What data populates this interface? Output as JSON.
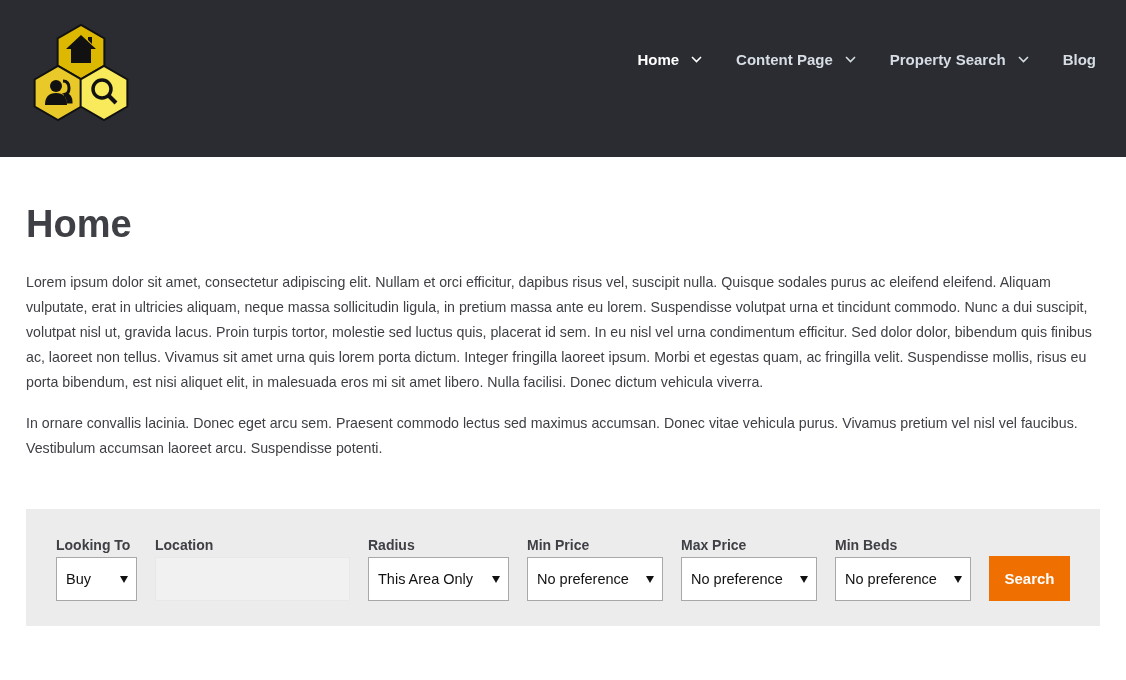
{
  "nav": [
    {
      "label": "Home",
      "selected": true,
      "kind": "dropdown"
    },
    {
      "label": "Content Page",
      "selected": false,
      "kind": "dropdown"
    },
    {
      "label": "Property Search",
      "selected": false,
      "kind": "dropdown"
    },
    {
      "label": "Blog",
      "selected": false,
      "kind": "link"
    }
  ],
  "page": {
    "title": "Home",
    "paragraphs": [
      "Lorem ipsum dolor sit amet, consectetur adipiscing elit. Nullam et orci efficitur, dapibus risus vel, suscipit nulla. Quisque sodales purus ac eleifend eleifend. Aliquam vulputate, erat in ultricies aliquam, neque massa sollicitudin ligula, in pretium massa ante eu lorem. Suspendisse volutpat urna et tincidunt commodo. Nunc a dui suscipit, volutpat nisl ut, gravida lacus. Proin turpis tortor, molestie sed luctus quis, placerat id sem. In eu nisl vel urna condimentum efficitur. Sed dolor dolor, bibendum quis finibus ac, laoreet non tellus. Vivamus sit amet urna quis lorem porta dictum. Integer fringilla laoreet ipsum. Morbi et egestas quam, ac fringilla velit. Suspendisse mollis, risus eu porta bibendum, est nisi aliquet elit, in malesuada eros mi sit amet libero. Nulla facilisi. Donec dictum vehicula viverra.",
      "In ornare convallis lacinia. Donec eget arcu sem. Praesent commodo lectus sed maximus accumsan. Donec vitae vehicula purus. Vivamus pretium vel nisl vel faucibus. Vestibulum accumsan laoreet arcu. Suspendisse potenti."
    ]
  },
  "search_form": {
    "fields": [
      {
        "label": "Looking To",
        "kind": "select",
        "value": "Buy"
      },
      {
        "label": "Location",
        "kind": "text"
      },
      {
        "label": "Radius",
        "kind": "select",
        "value": "This Area Only"
      },
      {
        "label": "Min Price",
        "kind": "select",
        "value": "No preference"
      },
      {
        "label": "Max Price",
        "kind": "select",
        "value": "No preference"
      },
      {
        "label": "Min Beds",
        "kind": "select",
        "value": "No preference"
      }
    ],
    "button": "Search"
  }
}
